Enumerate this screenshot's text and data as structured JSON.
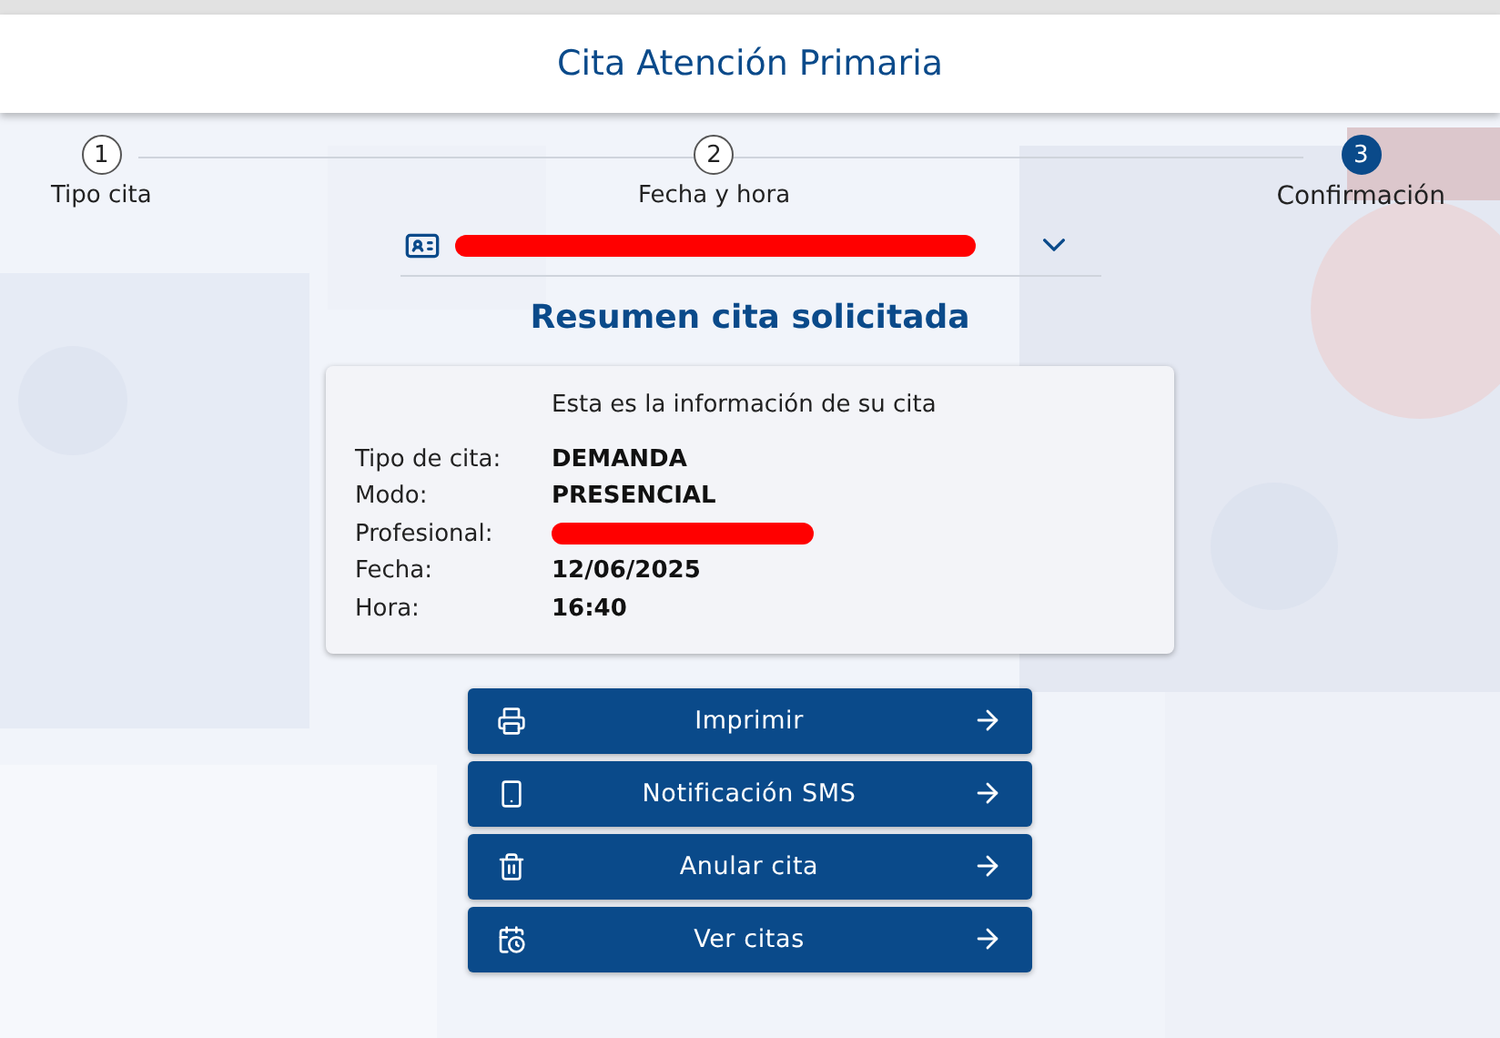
{
  "header": {
    "title": "Cita Atención Primaria"
  },
  "steps": [
    {
      "number": "1",
      "label": "Tipo cita",
      "selected": false
    },
    {
      "number": "2",
      "label": "Fecha y hora",
      "selected": false
    },
    {
      "number": "3",
      "label": "Confirmación",
      "selected": true
    }
  ],
  "patient_select": {
    "redacted": true
  },
  "section_title": "Resumen cita solicitada",
  "summary": {
    "intro": "Esta es la información de su cita",
    "rows": [
      {
        "label": "Tipo de cita:",
        "value": "DEMANDA",
        "kind": "text"
      },
      {
        "label": "Modo:",
        "value": "PRESENCIAL",
        "kind": "text"
      },
      {
        "label": "Profesional:",
        "kind": "redacted"
      },
      {
        "label": "Fecha:",
        "value": "12/06/2025",
        "kind": "text"
      },
      {
        "label": "Hora:",
        "value": "16:40",
        "kind": "text"
      }
    ]
  },
  "actions": [
    {
      "label": "Imprimir",
      "kind": "print"
    },
    {
      "label": "Notificación SMS",
      "kind": "phone"
    },
    {
      "label": "Anular cita",
      "kind": "trash"
    },
    {
      "label": "Ver citas",
      "kind": "calendar"
    }
  ]
}
